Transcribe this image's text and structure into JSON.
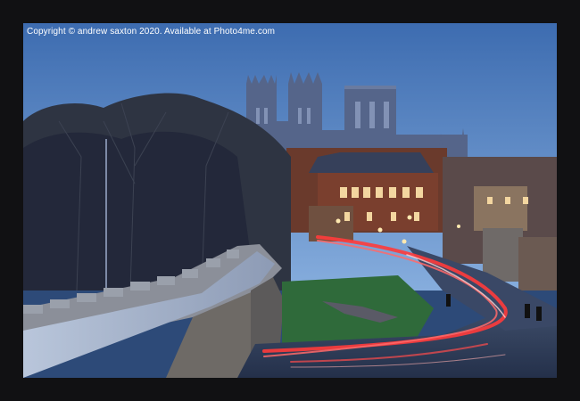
{
  "image": {
    "watermark": "Copyright  © andrew saxton  2020. Available at Photo4me.com"
  },
  "colors": {
    "frame": "#111113",
    "sky_top": "#3d6cb0",
    "sky_bottom": "#7ea7d8",
    "light_trail": "#ff3b3b",
    "grass": "#2f6a3a"
  }
}
